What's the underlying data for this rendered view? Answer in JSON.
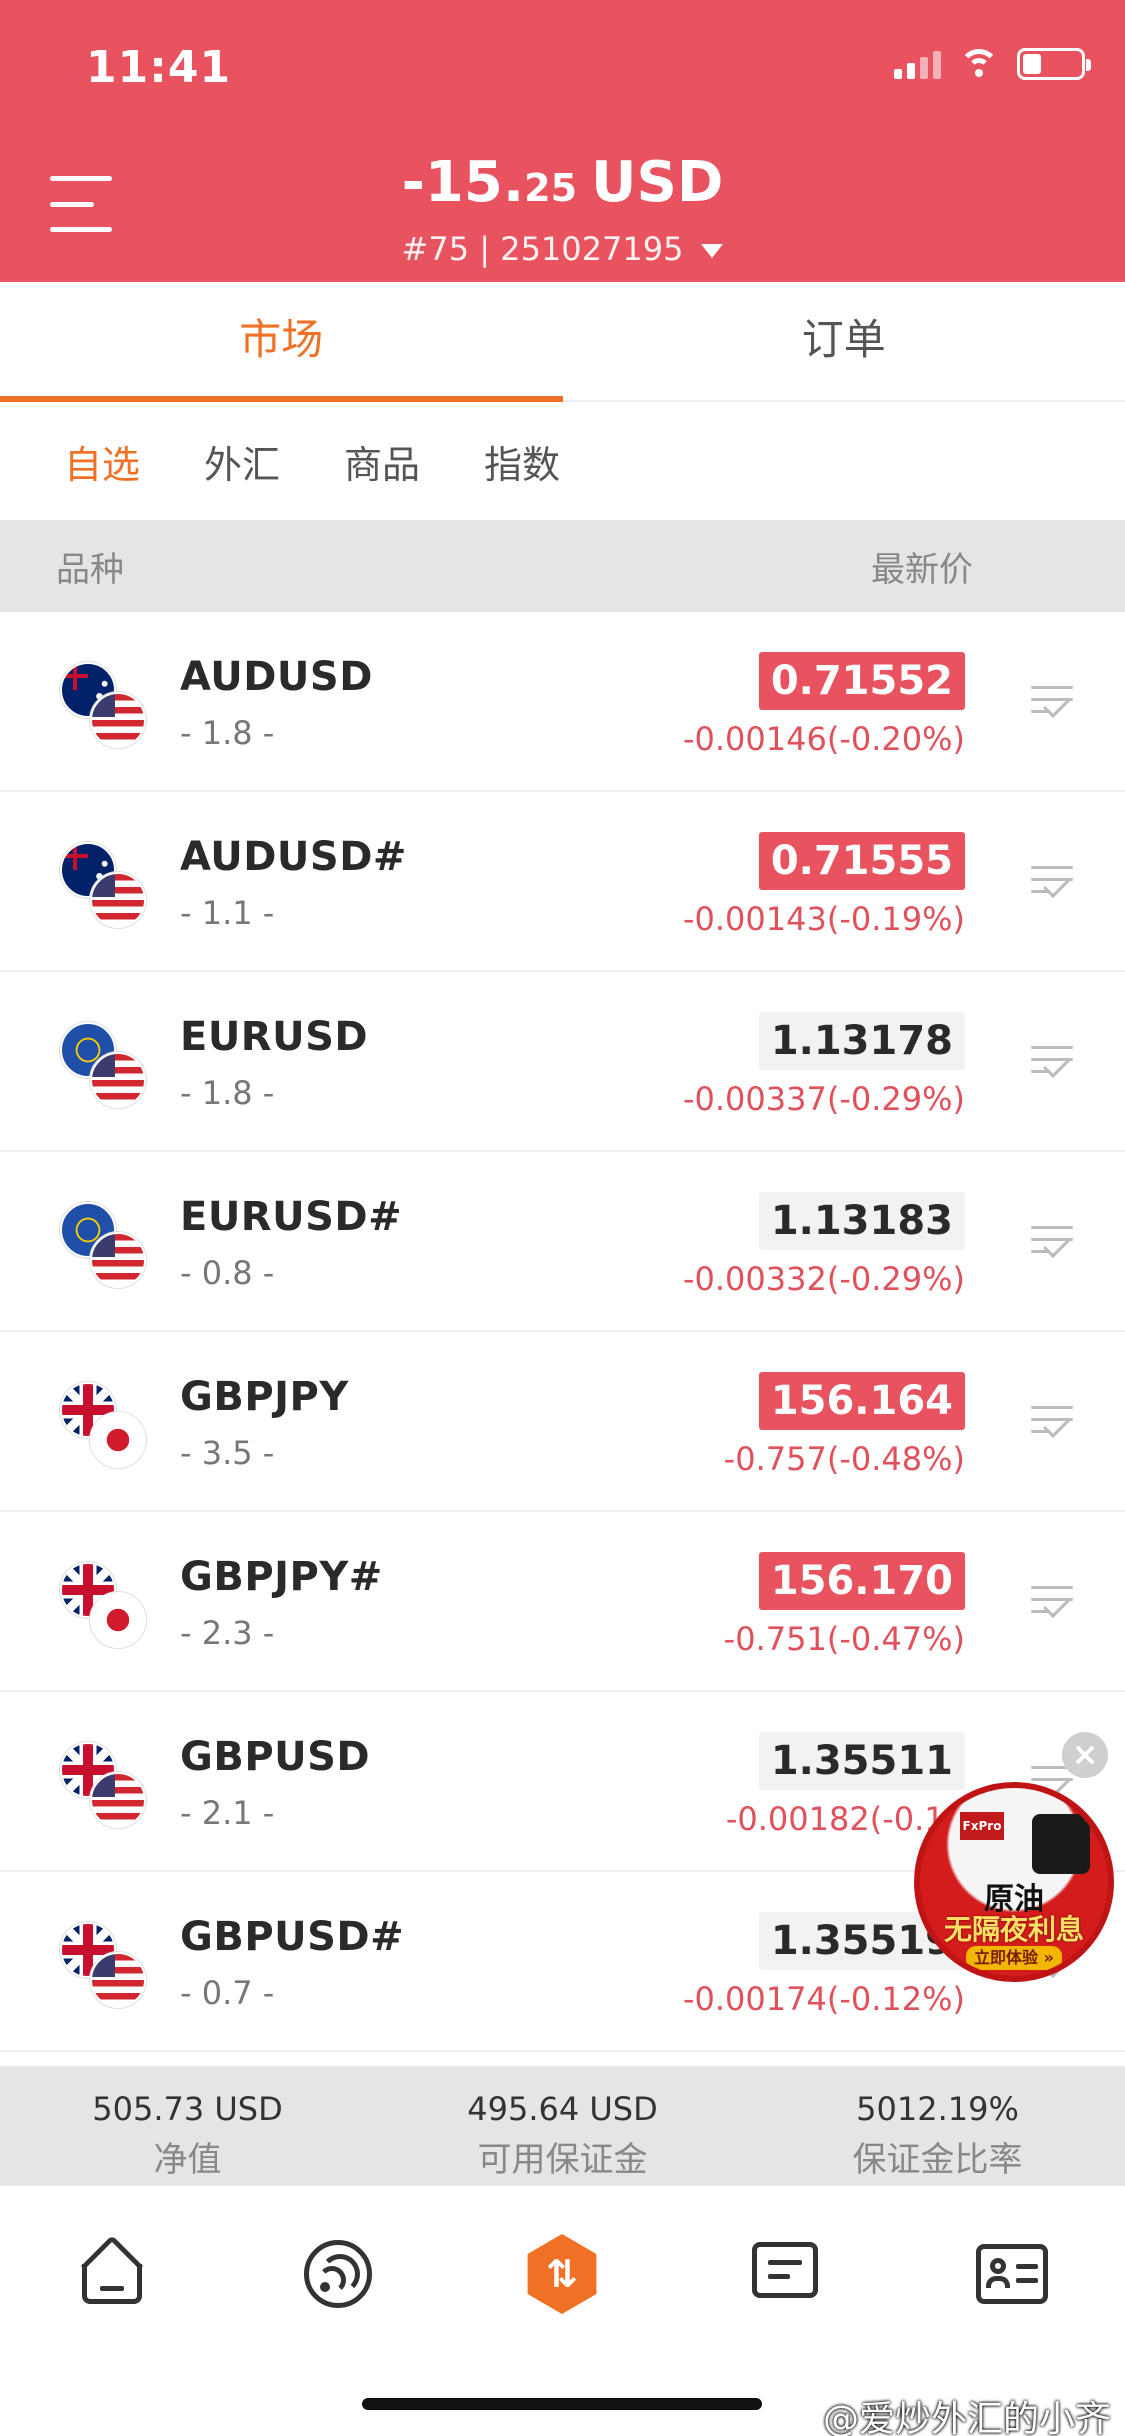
{
  "status_bar": {
    "time": "11:41"
  },
  "header": {
    "balance_int": "-15.",
    "balance_dec": "25",
    "balance_currency": "USD",
    "account": "#75 | 251027195",
    "bg_color": "#e8535f"
  },
  "main_tabs": [
    {
      "label": "市场",
      "active": true
    },
    {
      "label": "订单",
      "active": false
    }
  ],
  "sub_tabs": [
    {
      "label": "自选",
      "active": true
    },
    {
      "label": "外汇",
      "active": false
    },
    {
      "label": "商品",
      "active": false
    },
    {
      "label": "指数",
      "active": false
    }
  ],
  "list_header": {
    "left": "品种",
    "right": "最新价"
  },
  "instruments": [
    {
      "symbol": "AUDUSD",
      "spread": "- 1.8 -",
      "price": "0.71552",
      "change": "-0.00146(-0.20%)",
      "highlight": true,
      "base_flag": "au-flag-icon",
      "quote_flag": "us-flag-icon"
    },
    {
      "symbol": "AUDUSD#",
      "spread": "- 1.1 -",
      "price": "0.71555",
      "change": "-0.00143(-0.19%)",
      "highlight": true,
      "base_flag": "au-flag-icon",
      "quote_flag": "us-flag-icon"
    },
    {
      "symbol": "EURUSD",
      "spread": "- 1.8 -",
      "price": "1.13178",
      "change": "-0.00337(-0.29%)",
      "highlight": false,
      "base_flag": "eu-flag-icon",
      "quote_flag": "us-flag-icon"
    },
    {
      "symbol": "EURUSD#",
      "spread": "- 0.8 -",
      "price": "1.13183",
      "change": "-0.00332(-0.29%)",
      "highlight": false,
      "base_flag": "eu-flag-icon",
      "quote_flag": "us-flag-icon"
    },
    {
      "symbol": "GBPJPY",
      "spread": "- 3.5 -",
      "price": "156.164",
      "change": "-0.757(-0.48%)",
      "highlight": true,
      "base_flag": "gb-flag-icon",
      "quote_flag": "jp-flag-icon"
    },
    {
      "symbol": "GBPJPY#",
      "spread": "- 2.3 -",
      "price": "156.170",
      "change": "-0.751(-0.47%)",
      "highlight": true,
      "base_flag": "gb-flag-icon",
      "quote_flag": "jp-flag-icon"
    },
    {
      "symbol": "GBPUSD",
      "spread": "- 2.1 -",
      "price": "1.35511",
      "change": "-0.00182(-0.13",
      "highlight": false,
      "base_flag": "gb-flag-icon",
      "quote_flag": "us-flag-icon"
    },
    {
      "symbol": "GBPUSD#",
      "spread": "- 0.7 -",
      "price": "1.35519",
      "change": "-0.00174(-0.12%)",
      "highlight": false,
      "base_flag": "gb-flag-icon",
      "quote_flag": "us-flag-icon"
    }
  ],
  "summary": [
    {
      "value": "505.73 USD",
      "label": "净值"
    },
    {
      "value": "495.64 USD",
      "label": "可用保证金"
    },
    {
      "value": "5012.19%",
      "label": "保证金比率"
    }
  ],
  "bottom_nav": [
    {
      "icon": "home-icon"
    },
    {
      "icon": "feed-icon"
    },
    {
      "icon": "trade-icon",
      "glyph": "⇅"
    },
    {
      "icon": "news-icon"
    },
    {
      "icon": "profile-icon"
    }
  ],
  "ad": {
    "brand": "FxPro",
    "title": "原油",
    "subtitle": "无隔夜利息",
    "cta": "立即体验 »",
    "close": "×"
  },
  "watermark": "@爱炒外汇的小齐",
  "colors": {
    "accent": "#f07125",
    "down": "#e8535f",
    "header": "#e8535f"
  }
}
